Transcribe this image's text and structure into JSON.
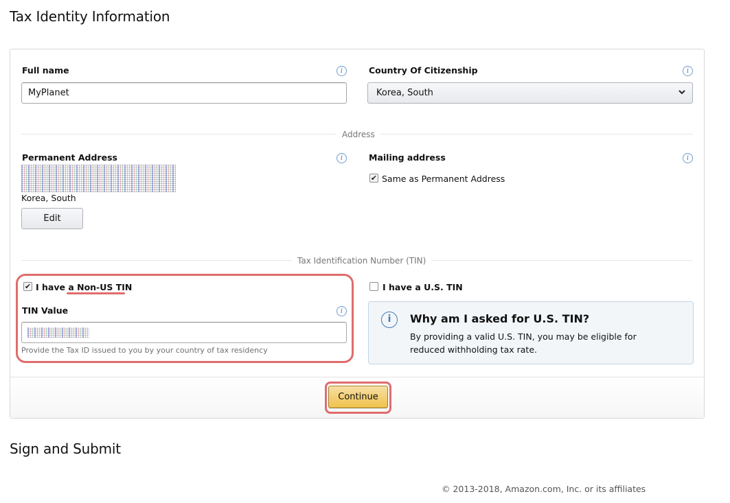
{
  "sections": {
    "tax_identity_title": "Tax Identity Information",
    "sign_submit_title": "Sign and Submit"
  },
  "form": {
    "full_name": {
      "label": "Full name",
      "value": "MyPlanet"
    },
    "country": {
      "label": "Country Of Citizenship",
      "value": "Korea, South"
    },
    "address_divider": "Address",
    "permanent_address": {
      "label": "Permanent Address",
      "country": "Korea, South",
      "edit_label": "Edit"
    },
    "mailing_address": {
      "label": "Mailing address",
      "same_as_label": "Same as Permanent Address",
      "same_as_checked": true
    },
    "tin_divider": "Tax Identification Number (TIN)",
    "non_us_tin": {
      "prefix": "I have a ",
      "emphasis": "Non-US TIN",
      "checked": true
    },
    "tin_value": {
      "label": "TIN Value",
      "help": "Provide the Tax ID issued to you by your country of tax residency"
    },
    "us_tin": {
      "label": "I have a U.S. TIN",
      "checked": false
    },
    "why_box": {
      "title": "Why am I asked for U.S. TIN?",
      "body": "By providing a valid U.S. TIN, you may be eligible for reduced withholding tax rate."
    },
    "continue_label": "Continue"
  },
  "icons": {
    "info": "info-icon",
    "chevron": "chevron-down-icon",
    "check": "checkmark-icon"
  },
  "colors": {
    "annotation": "#e06c6c",
    "primary_button": "#f0c14b",
    "info_accent": "#3f79b5"
  },
  "footer": {
    "copyright": "© 2013-2018, Amazon.com, Inc. or its affiliates"
  }
}
